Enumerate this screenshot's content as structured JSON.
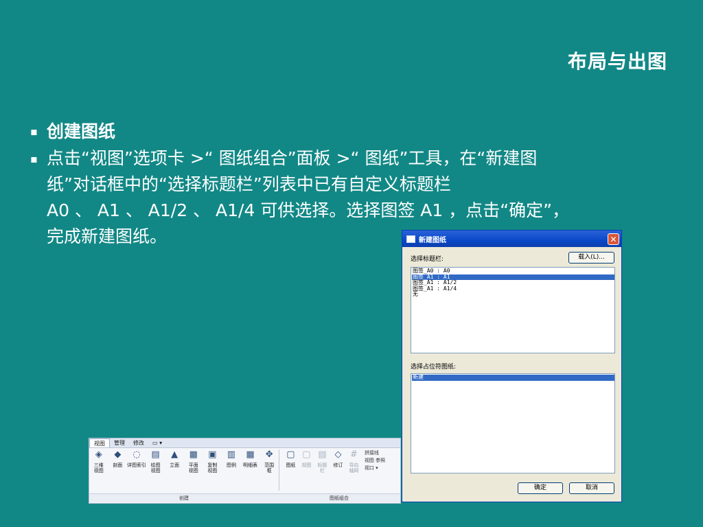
{
  "slide": {
    "title": "布局与出图",
    "bullets": [
      {
        "marker": "▪",
        "lines": [
          "创建图纸"
        ]
      },
      {
        "marker": "▪",
        "lines": [
          "点击“视图”选项卡 >“ 图纸组合”面板 >“ 图纸”工具，在“新建图",
          "纸”对话框中的“选择标题栏”列表中已有自定义标题栏",
          "A0 、 A1 、 A1/2 、 A1/4 可供选择。选择图签 A1 ，点击“确定”，",
          "完成新建图纸。"
        ]
      }
    ]
  },
  "ribbon": {
    "tabs": [
      "视图",
      "管理",
      "修改",
      "▭ ▾"
    ],
    "tools_create": [
      {
        "label": "三维\n视图",
        "icon": "◈"
      },
      {
        "label": "剖面",
        "icon": "◆"
      },
      {
        "label": "详图索引",
        "icon": "◌"
      },
      {
        "label": "绘图\n视图",
        "icon": "▤"
      },
      {
        "label": "立面",
        "icon": "▲"
      },
      {
        "label": "平面\n视图",
        "icon": "▦"
      },
      {
        "label": "复制\n视图",
        "icon": "▣"
      },
      {
        "label": "图例",
        "icon": "▥"
      },
      {
        "label": "明细表",
        "icon": "▦"
      },
      {
        "label": "范围\n框",
        "icon": "✥"
      }
    ],
    "tools_sheet": [
      {
        "label": "图纸",
        "icon": "▢",
        "dim": false
      },
      {
        "label": "视图",
        "icon": "▢",
        "dim": true
      },
      {
        "label": "标题\n栏",
        "icon": "▤",
        "dim": true
      },
      {
        "label": "修订",
        "icon": "◇",
        "dim": false
      },
      {
        "label": "导向\n轴网",
        "icon": "#",
        "dim": true
      }
    ],
    "side_tools": [
      "拼接线",
      "视图 参照",
      "视口 ▾"
    ],
    "panel_labels": [
      "创建",
      "图纸组合"
    ]
  },
  "dialog": {
    "title": "新建图纸",
    "close_glyph": "✕",
    "titleblock_label": "选择标题栏:",
    "load_button": "载入(L)...",
    "titleblocks": [
      "图签_A0 : A0",
      "图签_A1 : A1",
      "图签_A1 : A1/2",
      "图签_A1 : A1/4",
      "无"
    ],
    "selected_titleblock": 1,
    "placeholder_label": "选择占位符图纸:",
    "placeholder_items": [
      "新建"
    ],
    "ok_button": "确定",
    "cancel_button": "取消"
  }
}
